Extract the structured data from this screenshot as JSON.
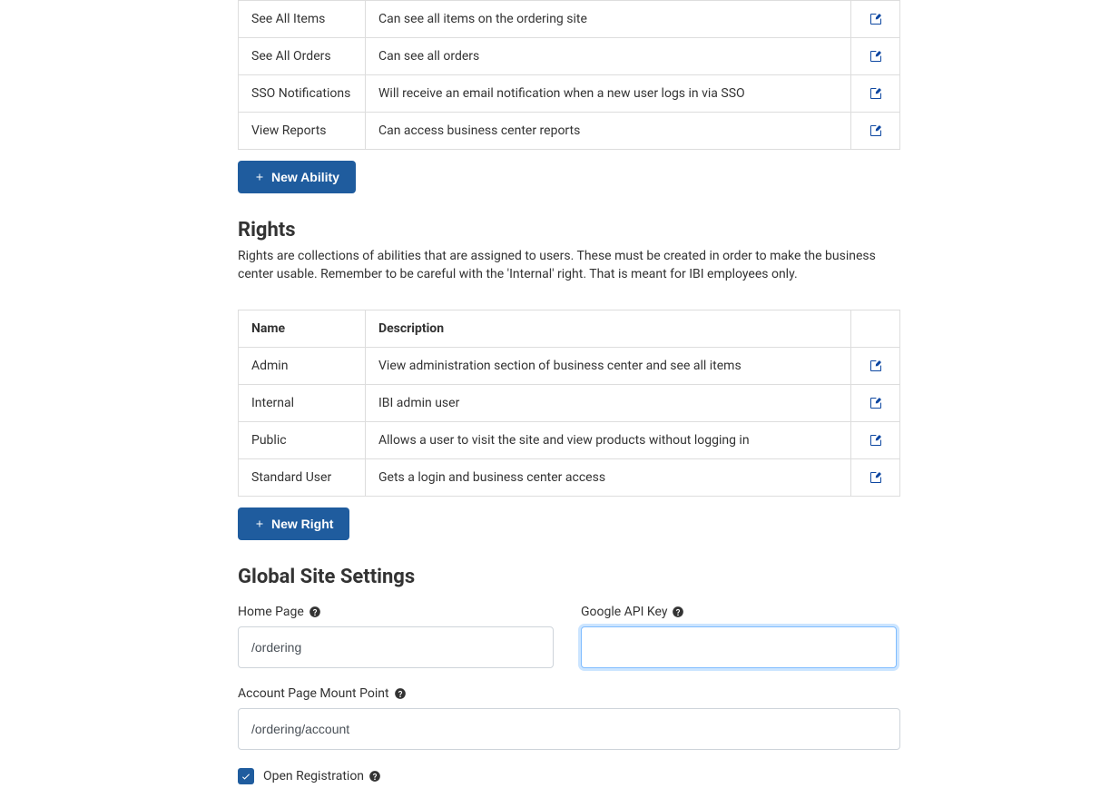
{
  "colors": {
    "primary": "#1f5c9e",
    "icon_blue": "#0d47a1",
    "border": "#ddd",
    "text": "#333",
    "focus_ring": "#80bdff"
  },
  "abilities_table": {
    "rows": [
      {
        "name": "See All Items",
        "description": "Can see all items on the ordering site"
      },
      {
        "name": "See All Orders",
        "description": "Can see all orders"
      },
      {
        "name": "SSO Notifications",
        "description": "Will receive an email notification when a new user logs in via SSO"
      },
      {
        "name": "View Reports",
        "description": "Can access business center reports"
      }
    ]
  },
  "new_ability_button": "New Ability",
  "rights_section": {
    "title": "Rights",
    "description": "Rights are collections of abilities that are assigned to users. These must be created in order to make the business center usable. Remember to be careful with the 'Internal' right. That is meant for IBI employees only.",
    "headers": {
      "name": "Name",
      "description": "Description"
    },
    "rows": [
      {
        "name": "Admin",
        "description": "View administration section of business center and see all items"
      },
      {
        "name": "Internal",
        "description": "IBI admin user"
      },
      {
        "name": "Public",
        "description": "Allows a user to visit the site and view products without logging in"
      },
      {
        "name": "Standard User",
        "description": "Gets a login and business center access"
      }
    ]
  },
  "new_right_button": "New Right",
  "global_settings": {
    "title": "Global Site Settings",
    "home_page": {
      "label": "Home Page",
      "value": "/ordering"
    },
    "google_api_key": {
      "label": "Google API Key",
      "value": ""
    },
    "account_mount": {
      "label": "Account Page Mount Point",
      "value": "/ordering/account"
    },
    "open_registration": {
      "label": "Open Registration",
      "checked": true
    }
  }
}
